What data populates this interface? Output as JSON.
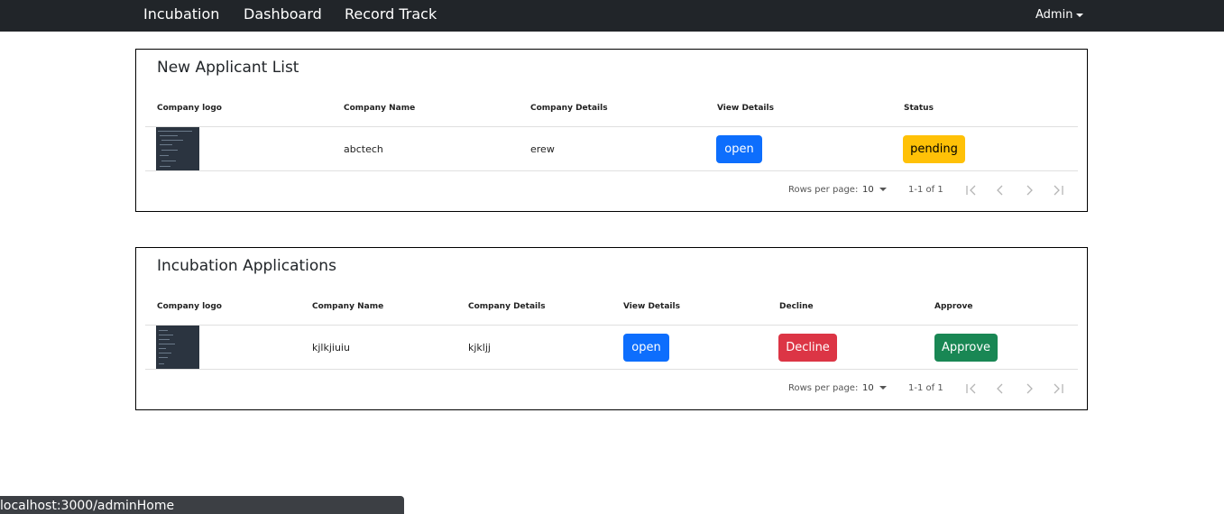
{
  "nav": {
    "items": [
      "Incubation",
      "Dashboard",
      "Record Track"
    ],
    "user_menu": "Admin"
  },
  "applicants": {
    "title": "New Applicant List",
    "columns": [
      "Company logo",
      "Company Name",
      "Company Details",
      "View Details",
      "Status"
    ],
    "rows": [
      {
        "company_name": "abctech",
        "company_details": "erew",
        "view_label": "open",
        "status_label": "pending"
      }
    ],
    "pagination": {
      "rows_label": "Rows per page:",
      "rows_value": "10",
      "range": "1-1 of 1"
    }
  },
  "applications": {
    "title": "Incubation Applications",
    "columns": [
      "Company logo",
      "Company Name",
      "Company Details",
      "View Details",
      "Decline",
      "Approve"
    ],
    "rows": [
      {
        "company_name": "kjlkjiuiu",
        "company_details": "kjkljj",
        "view_label": "open",
        "decline_label": "Decline",
        "approve_label": "Approve"
      }
    ],
    "pagination": {
      "rows_label": "Rows per page:",
      "rows_value": "10",
      "range": "1-1 of 1"
    }
  },
  "status_url": "localhost:3000/adminHome",
  "colors": {
    "navbar": "#212529",
    "primary": "#0d6efd",
    "warning": "#ffc107",
    "danger": "#dc3545",
    "success": "#198754"
  },
  "icons": [
    "first-page-icon",
    "prev-page-icon",
    "next-page-icon",
    "last-page-icon",
    "caret-down-icon"
  ]
}
